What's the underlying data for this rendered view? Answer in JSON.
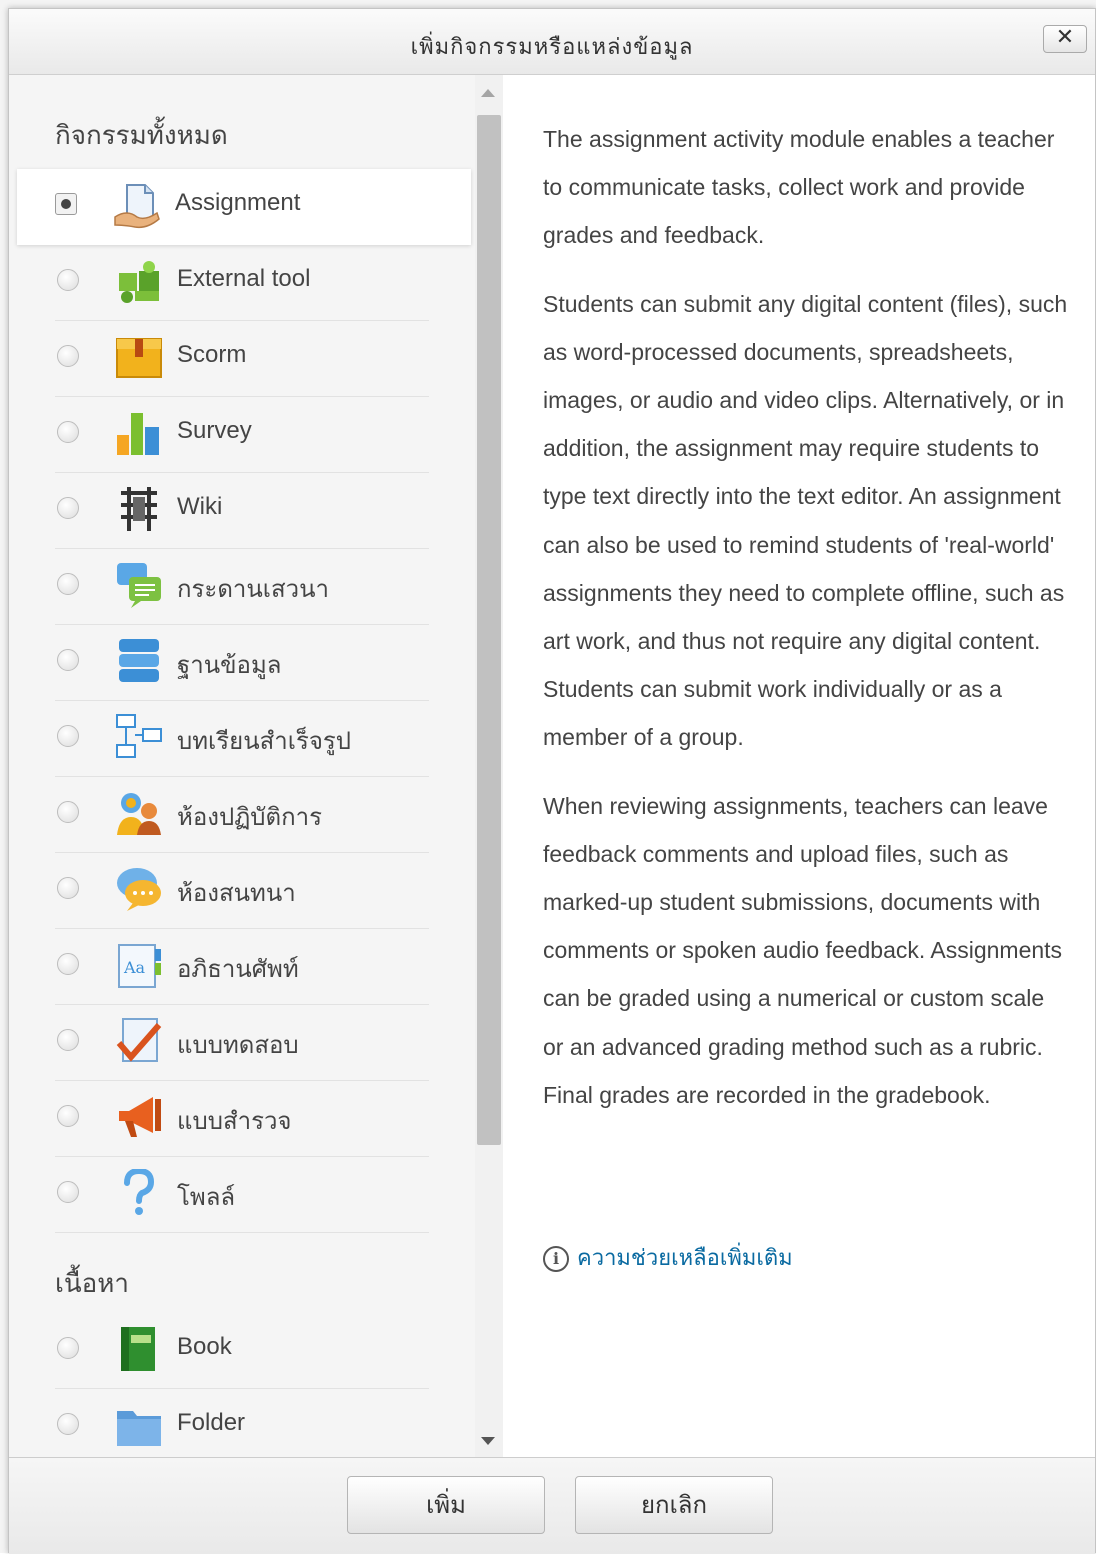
{
  "dialog": {
    "title": "เพิ่มกิจกรรมหรือแหล่งข้อมูล",
    "close_symbol": "✕"
  },
  "activities": {
    "section_title": "กิจกรรมทั้งหมด",
    "items": [
      {
        "label": "Assignment",
        "icon": "assignment-icon",
        "selected": true
      },
      {
        "label": "External tool",
        "icon": "puzzle-icon"
      },
      {
        "label": "Scorm",
        "icon": "scorm-package-icon"
      },
      {
        "label": "Survey",
        "icon": "bar-chart-icon"
      },
      {
        "label": "Wiki",
        "icon": "wiki-icon"
      },
      {
        "label": "กระดานเสวนา",
        "icon": "forum-icon"
      },
      {
        "label": "ฐานข้อมูล",
        "icon": "database-icon"
      },
      {
        "label": "บทเรียนสำเร็จรูป",
        "icon": "lesson-icon"
      },
      {
        "label": "ห้องปฏิบัติการ",
        "icon": "workshop-icon"
      },
      {
        "label": "ห้องสนทนา",
        "icon": "chat-icon"
      },
      {
        "label": "อภิธานศัพท์",
        "icon": "glossary-icon"
      },
      {
        "label": "แบบทดสอบ",
        "icon": "quiz-icon"
      },
      {
        "label": "แบบสำรวจ",
        "icon": "feedback-megaphone-icon"
      },
      {
        "label": "โพลล์",
        "icon": "question-icon"
      }
    ]
  },
  "resources": {
    "section_title": "เนื้อหา",
    "items": [
      {
        "label": "Book",
        "icon": "book-icon"
      },
      {
        "label": "Folder",
        "icon": "folder-icon"
      }
    ]
  },
  "description": {
    "paragraphs": [
      "The assignment activity module enables a teacher to communicate tasks, collect work and provide grades and feedback.",
      "Students can submit any digital content (files), such as word-processed documents, spreadsheets, images, or audio and video clips. Alternatively, or in addition, the assignment may require students to type text directly into the text editor. An assignment can also be used to remind students of 'real-world' assignments they need to complete offline, such as art work, and thus not require any digital content. Students can submit work individually or as a member of a group.",
      "When reviewing assignments, teachers can leave feedback comments and upload files, such as marked-up student submissions, documents with comments or spoken audio feedback. Assignments can be graded using a numerical or custom scale or an advanced grading method such as a rubric. Final grades are recorded in the gradebook."
    ],
    "help_link": "ความช่วยเหลือเพิ่มเติม",
    "info_symbol": "i"
  },
  "footer": {
    "add_label": "เพิ่ม",
    "cancel_label": "ยกเลิก"
  }
}
